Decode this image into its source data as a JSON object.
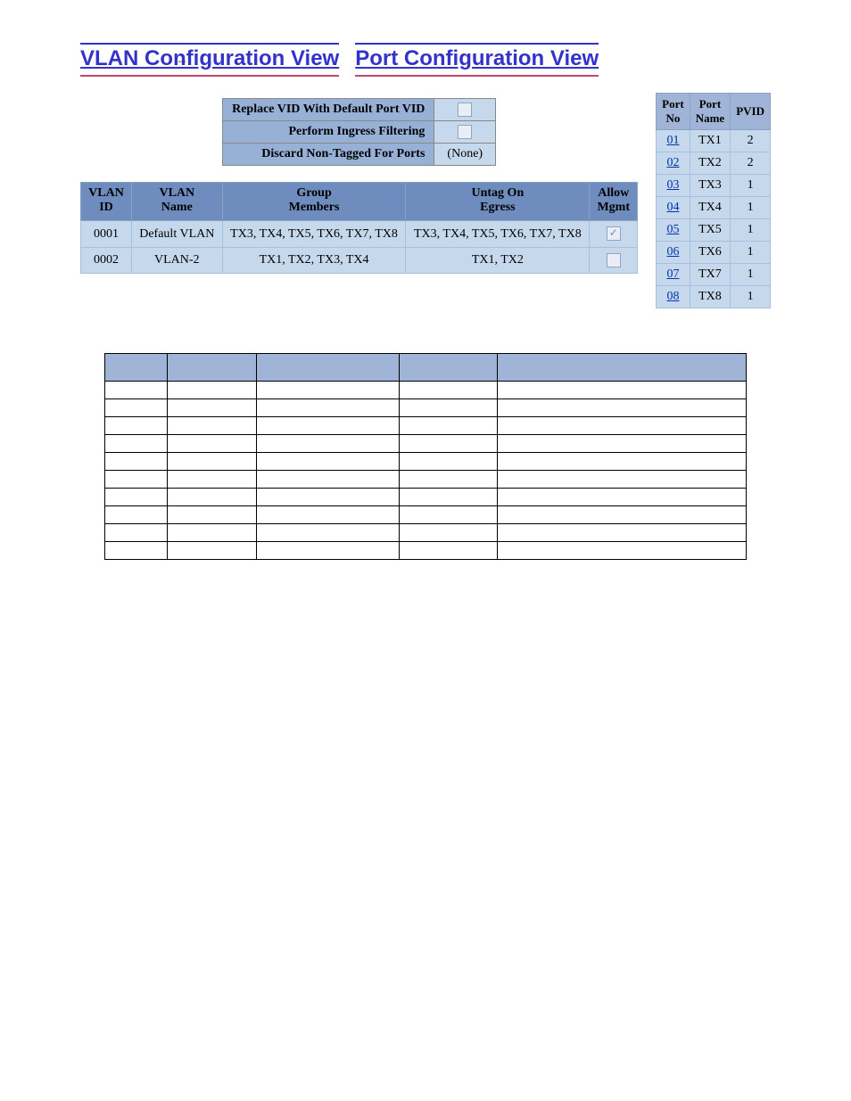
{
  "header": {
    "link_vlan": "VLAN Configuration View",
    "link_port": "Port Configuration View"
  },
  "settings": {
    "rows": [
      {
        "label": "Replace VID With Default Port VID",
        "type": "checkbox",
        "checked": false
      },
      {
        "label": "Perform Ingress Filtering",
        "type": "checkbox",
        "checked": false
      },
      {
        "label": "Discard Non-Tagged For Ports",
        "type": "text",
        "value": "(None)"
      }
    ]
  },
  "vlan_table": {
    "headers": [
      "VLAN\nID",
      "VLAN\nName",
      "Group\nMembers",
      "Untag On\nEgress",
      "Allow\nMgmt"
    ],
    "rows": [
      {
        "id": "0001",
        "name": "Default VLAN",
        "members": "TX3, TX4, TX5, TX6, TX7, TX8",
        "untag": "TX3, TX4, TX5, TX6, TX7, TX8",
        "allow_mgmt": true
      },
      {
        "id": "0002",
        "name": "VLAN-2",
        "members": "TX1, TX2, TX3, TX4",
        "untag": "TX1, TX2",
        "allow_mgmt": false
      }
    ]
  },
  "port_table": {
    "headers": [
      "Port\nNo",
      "Port\nName",
      "PVID"
    ],
    "rows": [
      {
        "no": "01",
        "name": "TX1",
        "pvid": "2"
      },
      {
        "no": "02",
        "name": "TX2",
        "pvid": "2"
      },
      {
        "no": "03",
        "name": "TX3",
        "pvid": "1"
      },
      {
        "no": "04",
        "name": "TX4",
        "pvid": "1"
      },
      {
        "no": "05",
        "name": "TX5",
        "pvid": "1"
      },
      {
        "no": "06",
        "name": "TX6",
        "pvid": "1"
      },
      {
        "no": "07",
        "name": "TX7",
        "pvid": "1"
      },
      {
        "no": "08",
        "name": "TX8",
        "pvid": "1"
      }
    ]
  },
  "blank_grid": {
    "cols": 5,
    "rows": 10
  }
}
